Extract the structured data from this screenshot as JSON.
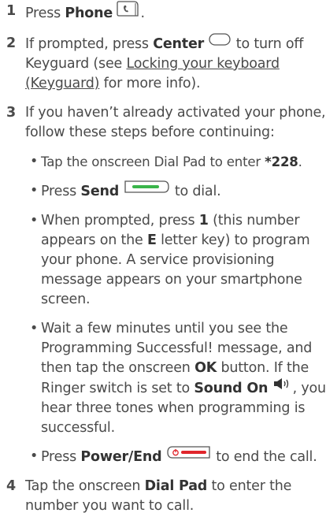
{
  "steps": [
    {
      "num": "1",
      "a": "Press ",
      "b": "Phone",
      "c": "."
    },
    {
      "num": "2",
      "a": "If prompted, press ",
      "b": "Center",
      "c": " to turn off Keyguard (see ",
      "link": "Locking your keyboard (Keyguard)",
      "d": " for more info)."
    },
    {
      "num": "3",
      "text": "If you haven’t already activated your phone, follow these steps before continuing:"
    },
    {
      "num": "4",
      "a": "Tap the onscreen ",
      "b": "Dial Pad",
      "c": " to enter the number you want to call."
    }
  ],
  "bullets": {
    "dial": {
      "a": "Tap the onscreen Dial Pad to enter ",
      "b": "*228",
      "c": "."
    },
    "send": {
      "a": "Press ",
      "b": "Send",
      "c": " to dial."
    },
    "prompted": {
      "a": "When prompted, press ",
      "b": "1",
      "c": " (this number appears on the ",
      "d": "E",
      "e": " letter key) to program your phone. A service provisioning message appears on your smartphone screen."
    },
    "wait": {
      "a": "Wait a few minutes until you see the Programming Successful! message, and then tap the onscreen ",
      "b": "OK",
      "c": " button. If the Ringer switch is set to ",
      "d": "Sound On",
      "e": ", you hear three tones when programming is successful."
    },
    "end": {
      "a": "Press ",
      "b": "Power/End",
      "c": " to end the call."
    }
  },
  "bullet_char": "•",
  "icons": [
    "phone-key-icon",
    "center-key-icon",
    "send-key-icon",
    "sound-on-icon",
    "power-end-key-icon"
  ],
  "colors": {
    "text": "#4a4a4a",
    "send_green": "#39b54a",
    "end_red": "#e0262c"
  }
}
